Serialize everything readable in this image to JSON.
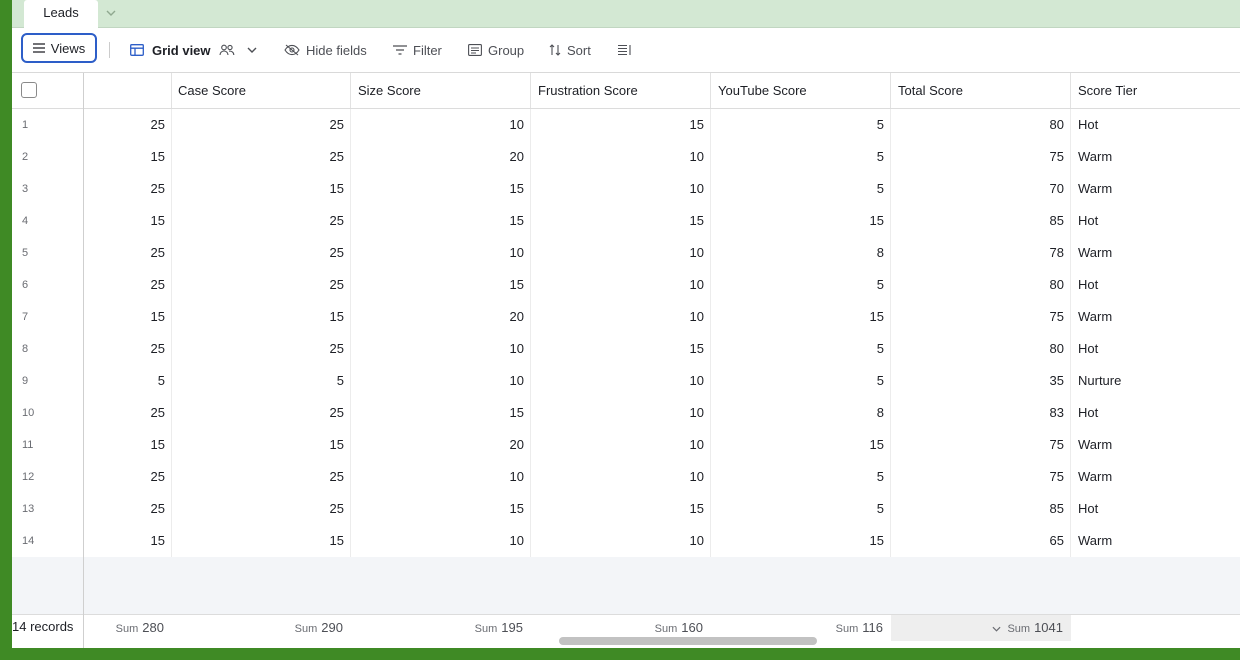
{
  "tabs": [
    {
      "label": "Leads"
    }
  ],
  "toolbar": {
    "views_label": "Views",
    "grid_view_label": "Grid view",
    "hide_fields_label": "Hide fields",
    "filter_label": "Filter",
    "group_label": "Group",
    "sort_label": "Sort"
  },
  "columns": [
    "",
    "Case Score",
    "Size Score",
    "Frustration Score",
    "YouTube Score",
    "Total Score",
    "Score Tier"
  ],
  "rows": [
    {
      "n": "1",
      "c": [
        "25",
        "25",
        "10",
        "15",
        "5",
        "80",
        "Hot"
      ]
    },
    {
      "n": "2",
      "c": [
        "15",
        "25",
        "20",
        "10",
        "5",
        "75",
        "Warm"
      ]
    },
    {
      "n": "3",
      "c": [
        "25",
        "15",
        "15",
        "10",
        "5",
        "70",
        "Warm"
      ]
    },
    {
      "n": "4",
      "c": [
        "15",
        "25",
        "15",
        "15",
        "15",
        "85",
        "Hot"
      ]
    },
    {
      "n": "5",
      "c": [
        "25",
        "25",
        "10",
        "10",
        "8",
        "78",
        "Warm"
      ]
    },
    {
      "n": "6",
      "c": [
        "25",
        "25",
        "15",
        "10",
        "5",
        "80",
        "Hot"
      ]
    },
    {
      "n": "7",
      "c": [
        "15",
        "15",
        "20",
        "10",
        "15",
        "75",
        "Warm"
      ]
    },
    {
      "n": "8",
      "c": [
        "25",
        "25",
        "10",
        "15",
        "5",
        "80",
        "Hot"
      ]
    },
    {
      "n": "9",
      "c": [
        "5",
        "5",
        "10",
        "10",
        "5",
        "35",
        "Nurture"
      ]
    },
    {
      "n": "10",
      "c": [
        "25",
        "25",
        "15",
        "10",
        "8",
        "83",
        "Hot"
      ]
    },
    {
      "n": "11",
      "c": [
        "15",
        "15",
        "20",
        "10",
        "15",
        "75",
        "Warm"
      ]
    },
    {
      "n": "12",
      "c": [
        "25",
        "25",
        "10",
        "10",
        "5",
        "75",
        "Warm"
      ]
    },
    {
      "n": "13",
      "c": [
        "25",
        "25",
        "15",
        "15",
        "5",
        "85",
        "Hot"
      ]
    },
    {
      "n": "14",
      "c": [
        "15",
        "15",
        "10",
        "10",
        "15",
        "65",
        "Warm"
      ]
    }
  ],
  "footer": {
    "records": "14 records",
    "sum_label": "Sum",
    "sums": [
      "280",
      "290",
      "195",
      "160",
      "116",
      "1041"
    ]
  }
}
